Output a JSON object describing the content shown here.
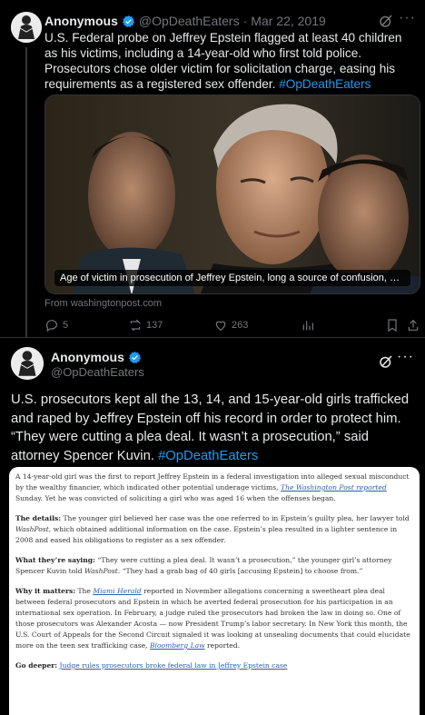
{
  "tweet1": {
    "name": "Anonymous",
    "handle": "@OpDeathEaters",
    "date": "Mar 22, 2019",
    "text": "U.S. Federal probe on Jeffrey Epstein flagged at least 40 children as his victims, including a 14-year-old who first told police. Prosecutors chose older victim for solicitation charge, easing his requirements as a registered sex offender.",
    "hashtag": "#OpDeathEaters",
    "caption": "Age of victim in prosecution of Jeffrey Epstein, long a source of confusion, eas...",
    "source": "From washingtonpost.com",
    "replies": "5",
    "reposts": "137",
    "likes": "263"
  },
  "tweet2": {
    "name": "Anonymous",
    "handle": "@OpDeathEaters",
    "text": "U.S. prosecutors kept all the 13, 14, and 15-year-old girls trafficked and raped by Jeffrey Epstein off his record in order to protect him. “They were cutting a plea deal. It wasn’t a prosecution,” said attorney Spencer Kuvin.",
    "hashtag": "#OpDeathEaters"
  },
  "article": {
    "p1_a": "A 14-year-old girl was the first to report Jeffrey Epstein in a federal investigation into alleged sexual misconduct by the wealthy financier, which indicated other potential underage victims,",
    "p1_link": "The Washington Post reported",
    "p1_b": " Sunday. Yet he was convicted of soliciting a girl who was aged 16 when the offenses began.",
    "p2_head": "The details:",
    "p2_a": " The younger girl believed her case was the one referred to in Epstein’s guilty plea, her lawyer told ",
    "p2_italic": "WashPost",
    "p2_b": ", which obtained additional information on the case. Epstein’s plea resulted in a lighter sentence in 2008 and eased his obligations to register as a sex offender.",
    "p3_head": "What they’re saying:",
    "p3_a": " “They were cutting a plea deal. It wasn’t a prosecution,” the younger girl’s attorney Spencer Kuvin told ",
    "p3_italic": "WashPost",
    "p3_b": ". “They had a grab bag of 40 girls [accusing Epstein] to choose from.”",
    "p4_head": "Why it matters:",
    "p4_a": " The ",
    "p4_link": "Miami Herald",
    "p4_b": " reported in November allegations concerning a sweetheart plea deal between federal prosecutors and Epstein in which he averted federal prosecution for his participation in an international sex operation. In February, a judge ruled the prosecutors had broken the law in doing so. One of those prosecutors was Alexander Acosta — now President Trump’s labor secretary. In New York this month, the U.S. Court of Appeals for the Second Circuit signaled it was looking at unsealing documents that could elucidate more on the teen sex trafficking case, ",
    "p4_link2": "Bloomberg Law",
    "p4_c": " reported.",
    "p5_head": "Go deeper:",
    "p5_link": "Judge rules prosecutors broke federal law in Jeffrey Epstein case"
  }
}
